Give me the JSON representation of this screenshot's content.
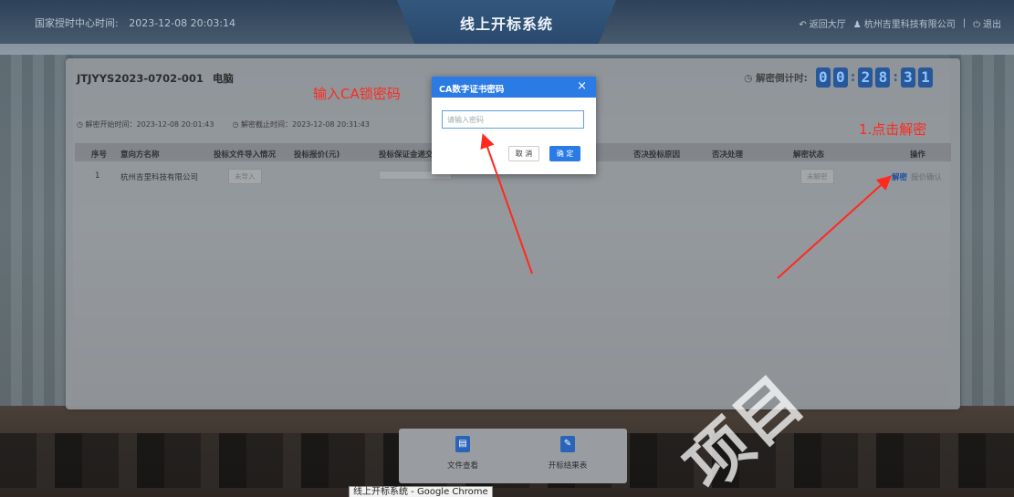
{
  "header": {
    "time_label": "国家授时中心时间:",
    "time_value": "2023-12-08 20:03:14",
    "title": "线上开标系统",
    "lobby_link": "返回大厅",
    "company": "杭州吉里科技有限公司",
    "separator": "|",
    "logout": "退出"
  },
  "panel": {
    "project_code": "JTJYYS2023-0702-001",
    "project_name": "电脑",
    "countdown_label": "解密倒计时:",
    "countdown_digits": [
      "0",
      "0",
      "2",
      "8",
      "3",
      "1"
    ],
    "decrypt_start": "◷ 解密开始时间：2023-12-08 20:01:43",
    "decrypt_end": "◷ 解密截止时间：2023-12-08 20:31:43"
  },
  "table": {
    "headers": [
      "序号",
      "意向方名称",
      "投标文件导入情况",
      "投标报价(元)",
      "投标保证金递交",
      "否决投标原因",
      "否决处理",
      "解密状态",
      "操作"
    ],
    "rows": [
      {
        "index": "1",
        "name": "杭州吉里科技有限公司",
        "import_status": "未导入",
        "decrypt_status": "未解密",
        "op_decrypt": "解密",
        "op_confirm": "报价确认"
      }
    ]
  },
  "modal": {
    "title": "CA数字证书密码",
    "placeholder": "请输入密码",
    "cancel": "取 消",
    "ok": "确 定",
    "close": "×"
  },
  "footer": {
    "file_view": "文件查看",
    "result_table": "开标结果表",
    "tooltip": "线上开标系统 - Google Chrome"
  },
  "annotations": {
    "input_hint": "输入CA锁密码",
    "click_hint": "1.点击解密",
    "watermark": "项目"
  },
  "colors": {
    "accent": "#2b7be5",
    "annotation": "#ff2a1f",
    "digit_bg": "#27589a"
  }
}
